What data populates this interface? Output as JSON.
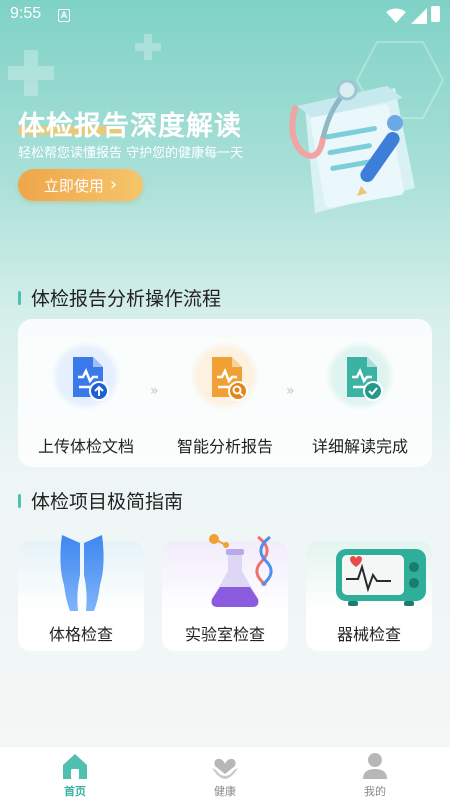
{
  "status_bar": {
    "time": "9:55",
    "notification_glyph": "A"
  },
  "banner": {
    "title": "体检报告深度解读",
    "subtitle": "轻松帮您读懂报告  守护您的健康每一天",
    "cta_label": "立即使用",
    "cta_chevron": "›"
  },
  "process_section": {
    "title": "体检报告分析操作流程",
    "steps": [
      {
        "label": "上传体检文档",
        "icon": "upload-document-icon",
        "color": "#3a79ea"
      },
      {
        "label": "智能分析报告",
        "icon": "analyze-document-icon",
        "color": "#f0a034"
      },
      {
        "label": "详细解读完成",
        "icon": "check-document-icon",
        "color": "#3bb3a3"
      }
    ],
    "separator": "»"
  },
  "guide_section": {
    "title": "体检项目极简指南",
    "items": [
      {
        "label": "体格检查",
        "icon": "body-legs-icon"
      },
      {
        "label": "实验室检查",
        "icon": "lab-flask-icon"
      },
      {
        "label": "器械检查",
        "icon": "monitor-device-icon"
      }
    ]
  },
  "bottom_nav": {
    "items": [
      {
        "label": "首页",
        "icon": "home-icon",
        "active": true
      },
      {
        "label": "健康",
        "icon": "health-heart-icon",
        "active": false
      },
      {
        "label": "我的",
        "icon": "profile-icon",
        "active": false
      }
    ]
  },
  "colors": {
    "accent": "#3bb3a3",
    "cta": "#f0a54a",
    "upload": "#3a79ea",
    "analyze": "#f0a034",
    "done": "#3bb3a3"
  }
}
